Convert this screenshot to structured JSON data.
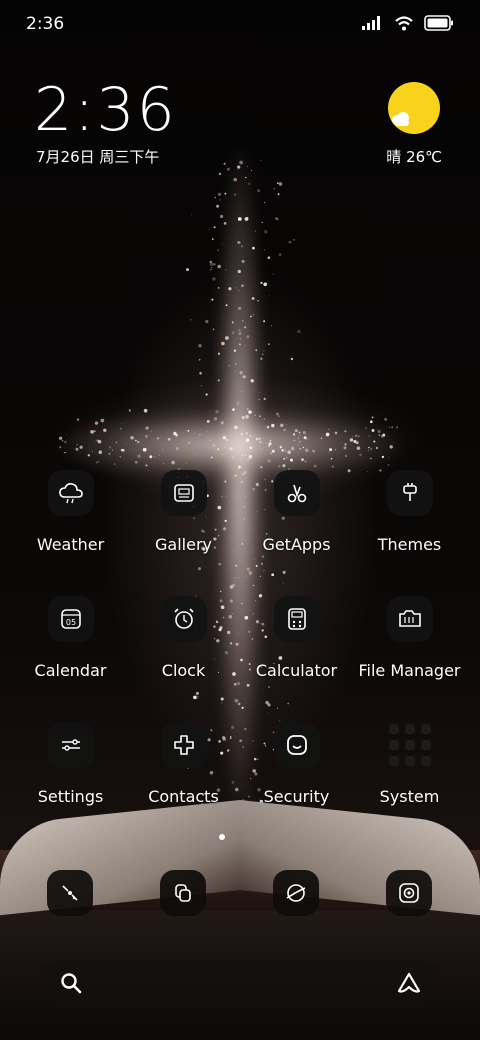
{
  "status_bar": {
    "time": "2:36"
  },
  "lockscreen_clock": {
    "time": "2:36",
    "date": "7月26日 周三下午"
  },
  "weather": {
    "temperature": "晴 26℃"
  },
  "apps": [
    {
      "label": "Weather",
      "icon": "weather-cloud-icon"
    },
    {
      "label": "Gallery",
      "icon": "gallery-icon"
    },
    {
      "label": "GetApps",
      "icon": "getapps-icon"
    },
    {
      "label": "Themes",
      "icon": "themes-brush-icon"
    },
    {
      "label": "Calendar",
      "icon": "calendar-icon",
      "badge": "05"
    },
    {
      "label": "Clock",
      "icon": "alarm-clock-icon"
    },
    {
      "label": "Calculator",
      "icon": "calculator-icon"
    },
    {
      "label": "File Manager",
      "icon": "folder-icon"
    },
    {
      "label": "Settings",
      "icon": "settings-sliders-icon"
    },
    {
      "label": "Contacts",
      "icon": "contacts-icon"
    },
    {
      "label": "Security",
      "icon": "security-shield-icon"
    },
    {
      "label": "System",
      "icon": "folder-grid-icon"
    }
  ],
  "dock": [
    "phone-icon",
    "messages-icon",
    "browser-icon",
    "camera-icon"
  ],
  "bottom_bar": {
    "left": "search-icon",
    "right": "assistant-icon"
  },
  "colors": {
    "sun": "#f8d21b",
    "icon_bg": "#121212",
    "text": "#ffffff"
  }
}
